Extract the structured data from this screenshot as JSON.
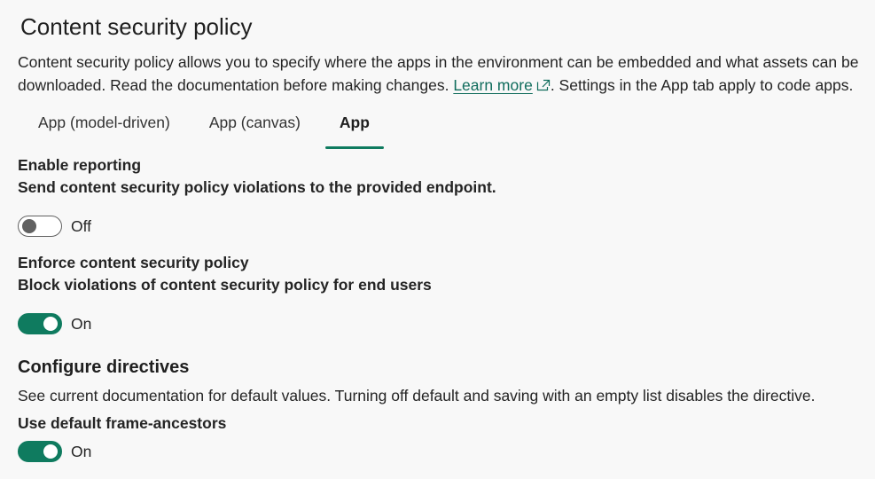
{
  "header": {
    "title": "Content security policy",
    "description_before_link": "Content security policy allows you to specify where the apps in the environment can be embedded and what assets can be downloaded. Read the documentation before making changes. ",
    "learn_more_label": "Learn more",
    "description_after_link": ". Settings in the App tab apply to code apps.",
    "link_icon": "external-link-icon"
  },
  "tabs": [
    {
      "label": "App (model-driven)",
      "active": false
    },
    {
      "label": "App (canvas)",
      "active": false
    },
    {
      "label": "App",
      "active": true
    }
  ],
  "reporting": {
    "title": "Enable reporting",
    "subtitle": "Send content security policy violations to the provided endpoint.",
    "toggle_state": "Off"
  },
  "enforce": {
    "title": "Enforce content security policy",
    "subtitle": "Block violations of content security policy for end users",
    "toggle_state": "On"
  },
  "directives": {
    "title": "Configure directives",
    "description": "See current documentation for default values. Turning off default and saving with an empty list disables the directive.",
    "frame_ancestors_label": "Use default frame-ancestors",
    "frame_ancestors_state": "On"
  },
  "colors": {
    "accent": "#0f7b5f",
    "link": "#0f6c5c",
    "background": "#f8f8f8"
  }
}
